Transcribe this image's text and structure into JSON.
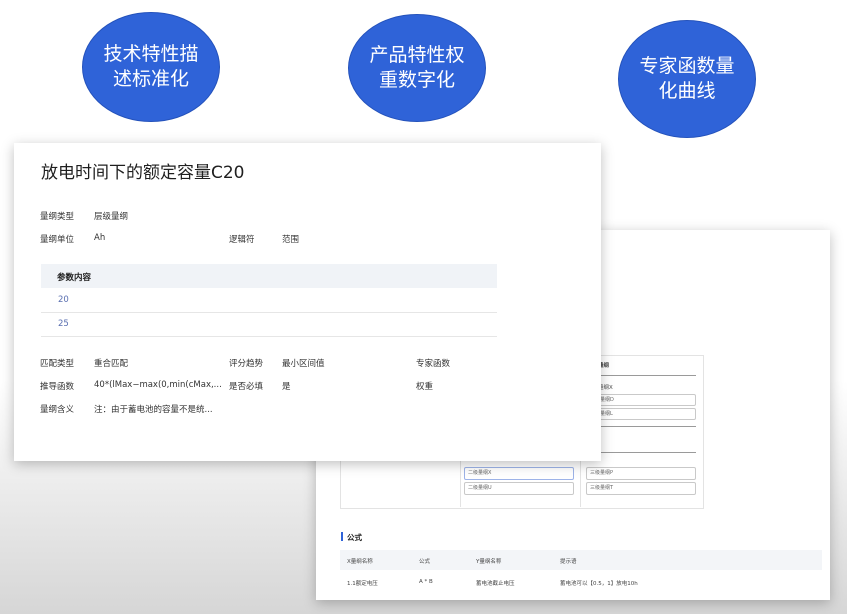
{
  "bubbles": [
    {
      "line1": "技术特性描",
      "line2": "述标准化"
    },
    {
      "line1": "产品特性权",
      "line2": "重数字化"
    },
    {
      "line1": "专家函数量",
      "line2": "化曲线"
    }
  ],
  "front": {
    "title": "放电时间下的额定容量C20",
    "dimension_type_label": "量纲类型",
    "dimension_type_value": "层级量纲",
    "unit_label": "量纲单位",
    "unit_value": "Ah",
    "logic_label": "逻辑符",
    "logic_value": "范围",
    "params_header": "参数内容",
    "params": [
      "20",
      "25"
    ],
    "match_type_label": "匹配类型",
    "match_type_value": "重合匹配",
    "trend_label": "评分趋势",
    "min_interval_label": "最小区间值",
    "expert_func_label": "专家函数",
    "derive_label": "推导函数",
    "derive_value": "40*(lMax−max(0,min(cMax,...",
    "required_label": "是否必填",
    "required_value": "是",
    "weight_label": "权重",
    "meaning_label": "量纲含义",
    "meaning_value": "注：由于蓄电池的容量不是统..."
  },
  "back": {
    "dim_header": "量纲",
    "dim_sub": "量纲X",
    "dim_box1": "量纲D",
    "dim_box2": "量纲L",
    "level2_a": "二级量纲X",
    "level2_b": "二级量纲U",
    "level3_a": "三级量纲P",
    "level3_b": "三级量纲T",
    "formula_title": "公式",
    "table_headers": [
      "X量纲名称",
      "公式",
      "Y量纲名称",
      "提示语"
    ],
    "table_rows": [
      [
        "1.1额定电压",
        "A * B",
        "蓄电池截止电压",
        "蓄电池可以【0.5，1】放电10h"
      ]
    ]
  }
}
